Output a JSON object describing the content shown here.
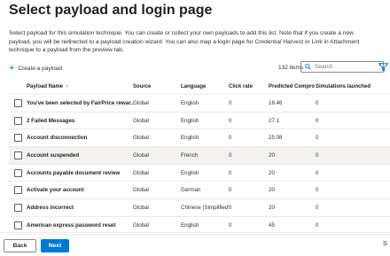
{
  "page": {
    "title": "Select payload and login page",
    "description": [
      "Select payload for this simulation technique. You can create or collect your own payloads to add this list. Note that if you create a new",
      "payload, you will be redirected to a payload creation wizard. You can also map a login page for Credential Harvest or Link in Attachment",
      "technique to a payload from the preview tab."
    ]
  },
  "toolbar": {
    "create_label": "Create a payload",
    "item_count": "132 items",
    "search_placeholder": "Search",
    "icons": [
      "plus-icon",
      "search-icon",
      "filter-icon"
    ]
  },
  "table": {
    "columns": [
      "Payload Name",
      "Source",
      "Language",
      "Click rate",
      "Predicted Compro...",
      "Simulations launched"
    ],
    "sort": {
      "column": "Payload Name",
      "direction": "ascending",
      "indicator": "↑"
    },
    "rows": [
      {
        "name": "You've been selected by FairPrice rewar...",
        "source": "Global",
        "language": "English",
        "click_rate": "0",
        "predicted": "18.46",
        "simulations": "0",
        "selected": false
      },
      {
        "name": "2 Failed Messages",
        "source": "Global",
        "language": "English",
        "click_rate": "0",
        "predicted": "27.1",
        "simulations": "0",
        "selected": false
      },
      {
        "name": "Account disconnection",
        "source": "Global",
        "language": "English",
        "click_rate": "0",
        "predicted": "25.08",
        "simulations": "0",
        "selected": false
      },
      {
        "name": "Account suspended",
        "source": "Global",
        "language": "French",
        "click_rate": "0",
        "predicted": "20",
        "simulations": "0",
        "selected": true
      },
      {
        "name": "Accounts payable document review",
        "source": "Global",
        "language": "English",
        "click_rate": "0",
        "predicted": "20",
        "simulations": "0",
        "selected": false
      },
      {
        "name": "Activate your account",
        "source": "Global",
        "language": "German",
        "click_rate": "0",
        "predicted": "20",
        "simulations": "0",
        "selected": false
      },
      {
        "name": "Address incorrect",
        "source": "Global",
        "language": "Chinese (Simplified)",
        "click_rate": "0",
        "predicted": "20",
        "simulations": "0",
        "selected": false
      },
      {
        "name": "American express password reset",
        "source": "Global",
        "language": "English",
        "click_rate": "0",
        "predicted": "45",
        "simulations": "0",
        "selected": false
      }
    ]
  },
  "footer": {
    "back_label": "Back",
    "next_label": "Next",
    "edge_label": "S"
  },
  "colors": {
    "accent": "#0078d4",
    "selected_row": "#f3f2f1",
    "divider": "#edebe9"
  }
}
